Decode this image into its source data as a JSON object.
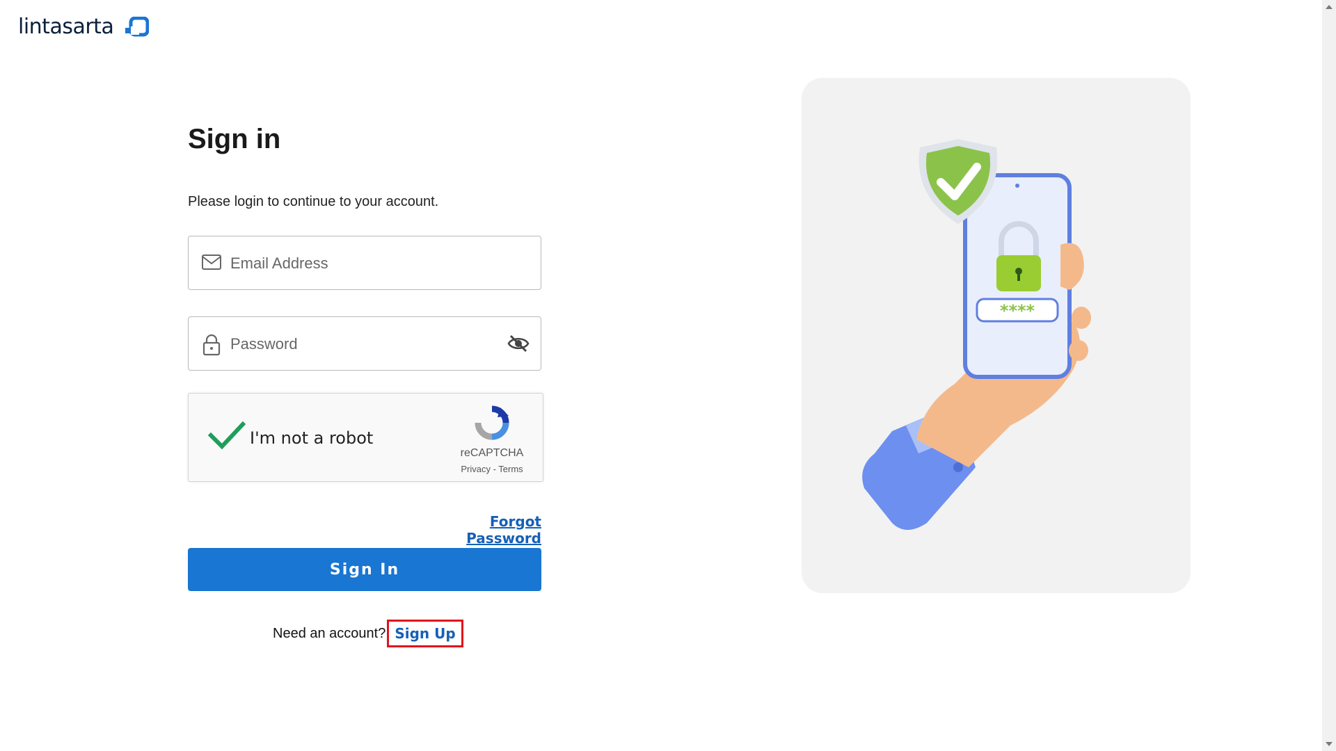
{
  "brand": {
    "name": "lintasarta"
  },
  "login": {
    "title": "Sign in",
    "subtitle": "Please login to continue to your account.",
    "email_placeholder": "Email Address",
    "password_placeholder": "Password",
    "forgot_password": "Forgot Password",
    "sign_in_button": "Sign In",
    "need_account": "Need an account?",
    "sign_up": "Sign Up"
  },
  "captcha": {
    "label": "I'm not a robot",
    "brand": "reCAPTCHA",
    "privacy": "Privacy",
    "separator": " - ",
    "terms": "Terms",
    "checked": true
  },
  "illustration": {
    "password_mask": "****"
  },
  "colors": {
    "primary": "#1976d2",
    "link": "#1560b7",
    "highlight": "#e0121c",
    "check": "#1e9e5a",
    "illustration_bg": "#f2f2f2"
  },
  "icons": [
    "mail-icon",
    "lock-icon",
    "eye-off-icon",
    "checkmark-icon",
    "recaptcha-icon"
  ]
}
